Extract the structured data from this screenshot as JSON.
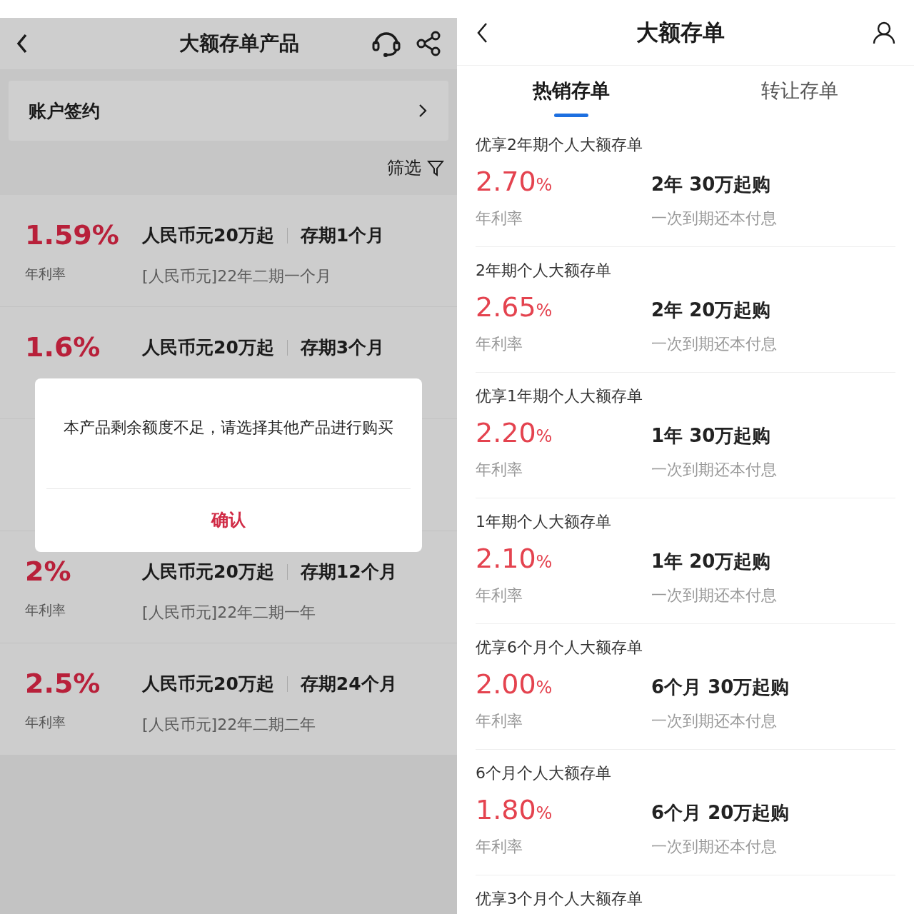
{
  "left_screen": {
    "title": "大额存单产品",
    "account_row": {
      "label": "账户签约"
    },
    "filter": {
      "label": "筛选"
    },
    "products": [
      {
        "kind": "product",
        "rate": "1.59%",
        "rate_label": "年利率",
        "amount": "人民币元20万起",
        "term": "存期1个月",
        "name": "[人民币元]22年二期一个月"
      },
      {
        "kind": "product",
        "rate": "1.6%",
        "amount": "人民币元20万起",
        "term": "存期3个月"
      },
      {
        "kind": "covered"
      },
      {
        "kind": "product",
        "rate": "2%",
        "rate_label": "年利率",
        "amount": "人民币元20万起",
        "term": "存期12个月",
        "name": "[人民币元]22年二期一年"
      },
      {
        "kind": "product",
        "rate": "2.5%",
        "rate_label": "年利率",
        "amount": "人民币元20万起",
        "term": "存期24个月",
        "name": "[人民币元]22年二期二年"
      }
    ],
    "dialog": {
      "message": "本产品剩余额度不足，请选择其他产品进行购买",
      "button": "确认"
    }
  },
  "right_screen": {
    "title": "大额存单",
    "tabs": [
      {
        "label": "热销存单",
        "selected": true
      },
      {
        "label": "转让存单",
        "selected": false
      }
    ],
    "products": [
      {
        "title": "优享2年期个人大额存单",
        "rate": "2.70",
        "unit": "%",
        "rate_label": "年利率",
        "terms": "2年 30万起购",
        "payment": "一次到期还本付息"
      },
      {
        "title": "2年期个人大额存单",
        "rate": "2.65",
        "unit": "%",
        "rate_label": "年利率",
        "terms": "2年 20万起购",
        "payment": "一次到期还本付息"
      },
      {
        "title": "优享1年期个人大额存单",
        "rate": "2.20",
        "unit": "%",
        "rate_label": "年利率",
        "terms": "1年 30万起购",
        "payment": "一次到期还本付息"
      },
      {
        "title": "1年期个人大额存单",
        "rate": "2.10",
        "unit": "%",
        "rate_label": "年利率",
        "terms": "1年 20万起购",
        "payment": "一次到期还本付息"
      },
      {
        "title": "优享6个月个人大额存单",
        "rate": "2.00",
        "unit": "%",
        "rate_label": "年利率",
        "terms": "6个月 30万起购",
        "payment": "一次到期还本付息"
      },
      {
        "title": "6个月个人大额存单",
        "rate": "1.80",
        "unit": "%",
        "rate_label": "年利率",
        "terms": "6个月 20万起购",
        "payment": "一次到期还本付息"
      },
      {
        "title": "优享3个月个人大额存单"
      }
    ]
  }
}
